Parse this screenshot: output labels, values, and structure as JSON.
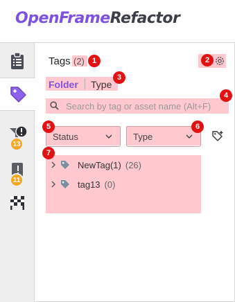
{
  "app": {
    "logo_part1": "OpenFrame",
    "logo_part2": "Refactor"
  },
  "sidebar": {
    "items": [
      {
        "name": "clipboard-list",
        "icon": "clipboard-icon"
      },
      {
        "name": "tags",
        "icon": "tag-icon",
        "active": true
      },
      {
        "name": "issues",
        "icon": "alert-funnel-icon",
        "badge": "13"
      },
      {
        "name": "pending",
        "icon": "puzzle-icon",
        "badge": "11"
      },
      {
        "name": "finish",
        "icon": "checkered-flag-icon"
      }
    ]
  },
  "panel": {
    "title": "Tags",
    "count": "(2)",
    "toggle": {
      "folder": "Folder",
      "type": "Type",
      "active": "Folder"
    },
    "search_placeholder": "Search by tag or asset name (Alt+F)",
    "filters": {
      "status": "Status",
      "type": "Type"
    },
    "tree": [
      {
        "label": "NewTag(1)",
        "count": "(26)"
      },
      {
        "label": "tag13",
        "count": "(0)"
      }
    ]
  },
  "markers": [
    "1",
    "2",
    "3",
    "4",
    "5",
    "6",
    "7"
  ],
  "colors": {
    "accent": "#7e52e0",
    "highlight": "#ffc9cf",
    "marker": "#e31212",
    "badge": "#f5a623",
    "tag_icon": "#7a8ea0"
  }
}
